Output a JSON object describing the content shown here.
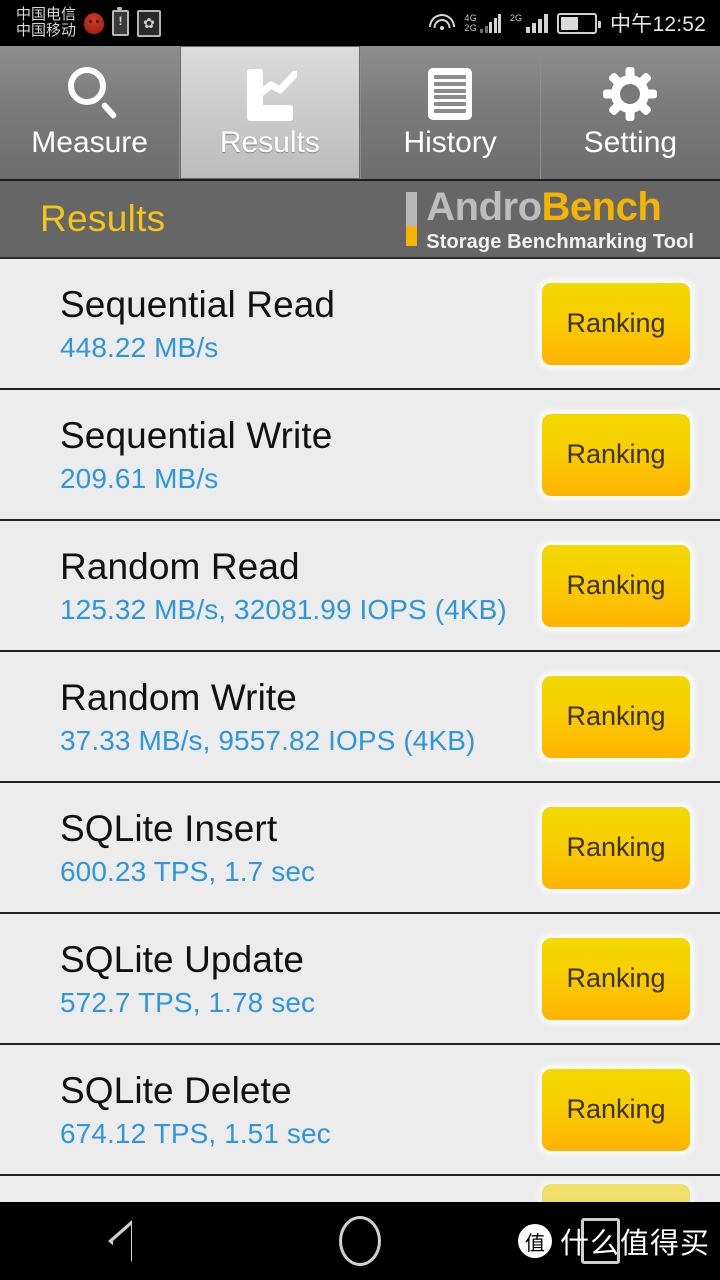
{
  "status_bar": {
    "carrier_primary": "中国电信",
    "carrier_secondary": "中国移动",
    "icons": [
      "angry-face-icon",
      "battery-alert-icon",
      "sim-card-icon",
      "wifi-icon",
      "signal-4g-icon",
      "signal-2g-icon",
      "battery-icon"
    ],
    "network_labels": {
      "sim1_top": "4G",
      "sim1_bottom": "2G",
      "sim2": "2G"
    },
    "clock": "中午12:52"
  },
  "tabs": [
    {
      "label": "Measure",
      "icon": "search-icon",
      "active": false
    },
    {
      "label": "Results",
      "icon": "chart-icon",
      "active": true
    },
    {
      "label": "History",
      "icon": "document-icon",
      "active": false
    },
    {
      "label": "Setting",
      "icon": "gear-icon",
      "active": false
    }
  ],
  "header": {
    "title": "Results",
    "logo_primary": "Andro",
    "logo_secondary": "Bench",
    "logo_tagline": "Storage Benchmarking Tool"
  },
  "results": {
    "ranking_label": "Ranking",
    "rows": [
      {
        "title": "Sequential Read",
        "value": "448.22 MB/s"
      },
      {
        "title": "Sequential Write",
        "value": "209.61 MB/s"
      },
      {
        "title": "Random Read",
        "value": "125.32 MB/s, 32081.99 IOPS (4KB)"
      },
      {
        "title": "Random Write",
        "value": "37.33 MB/s, 9557.82 IOPS (4KB)"
      },
      {
        "title": "SQLite Insert",
        "value": "600.23 TPS, 1.7 sec"
      },
      {
        "title": "SQLite Update",
        "value": "572.7 TPS, 1.78 sec"
      },
      {
        "title": "SQLite Delete",
        "value": "674.12 TPS, 1.51 sec"
      }
    ]
  },
  "nav_bar": {
    "back_label": "back-icon",
    "home_label": "home-icon",
    "recents_label": "recents-icon",
    "watermark_badge": "值",
    "watermark_text": "什么值得买"
  },
  "colors": {
    "accent_yellow": "#f5b400",
    "value_blue": "#2e96dd",
    "list_background": "#ececec",
    "header_gray": "#666666"
  }
}
